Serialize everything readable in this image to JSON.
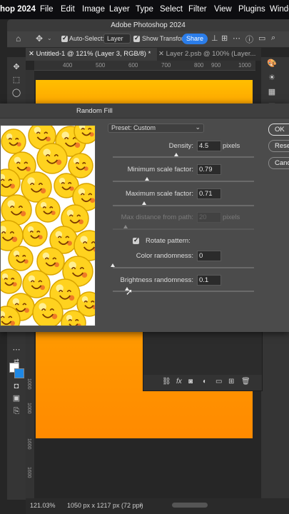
{
  "menubar": {
    "app": "hop 2024",
    "items": [
      "File",
      "Edit",
      "Image",
      "Layer",
      "Type",
      "Select",
      "Filter",
      "View",
      "Plugins",
      "Windo"
    ]
  },
  "window": {
    "title": "Adobe Photoshop 2024"
  },
  "options_bar": {
    "auto_select_label": "Auto-Select:",
    "auto_select_value": "Layer",
    "show_transform_label": "Show Transform",
    "share_label": "Share"
  },
  "tabs": [
    {
      "label": "Untitled-1 @ 121% (Layer 3, RGB/8) *"
    },
    {
      "label": "Layer 2.psb @ 100% (Layer..."
    }
  ],
  "ruler_top": [
    "400",
    "500",
    "600",
    "700",
    "800",
    "900",
    "1000"
  ],
  "ruler_left": [
    "1000",
    "1000",
    "1600",
    "1600"
  ],
  "dialog": {
    "title": "Random Fill",
    "preset_label": "Preset: Custom",
    "ok_label": "OK",
    "reset_label": "Rese",
    "cancel_label": "Cance",
    "density_label": "Density:",
    "density_value": "4.5",
    "density_unit": "pixels",
    "min_scale_label": "Minimum scale factor:",
    "min_scale_value": "0.79",
    "max_scale_label": "Maximum scale factor:",
    "max_scale_value": "0.71",
    "max_distance_label": "Max distance from path:",
    "max_distance_value": "20",
    "max_distance_unit": "pixels",
    "rotate_label": "Rotate pattern:",
    "color_rand_label": "Color randomness:",
    "color_rand_value": "0",
    "brightness_rand_label": "Brightness randomness:",
    "brightness_rand_value": "0.1",
    "slider_levels": {
      "density": 0.45,
      "min_scale": 0.24,
      "max_scale": 0.22,
      "max_distance": 0.09,
      "color_randomness": 0.0,
      "brightness_randomness": 0.1
    }
  },
  "status": {
    "zoom": "121.03%",
    "doc_info": "1050 px x 1217 px (72 ppi)"
  },
  "colors": {
    "accent": "#2b7de9",
    "canvas_orange": "#ff9a00",
    "emoji_yellow": "#ffd21f"
  }
}
